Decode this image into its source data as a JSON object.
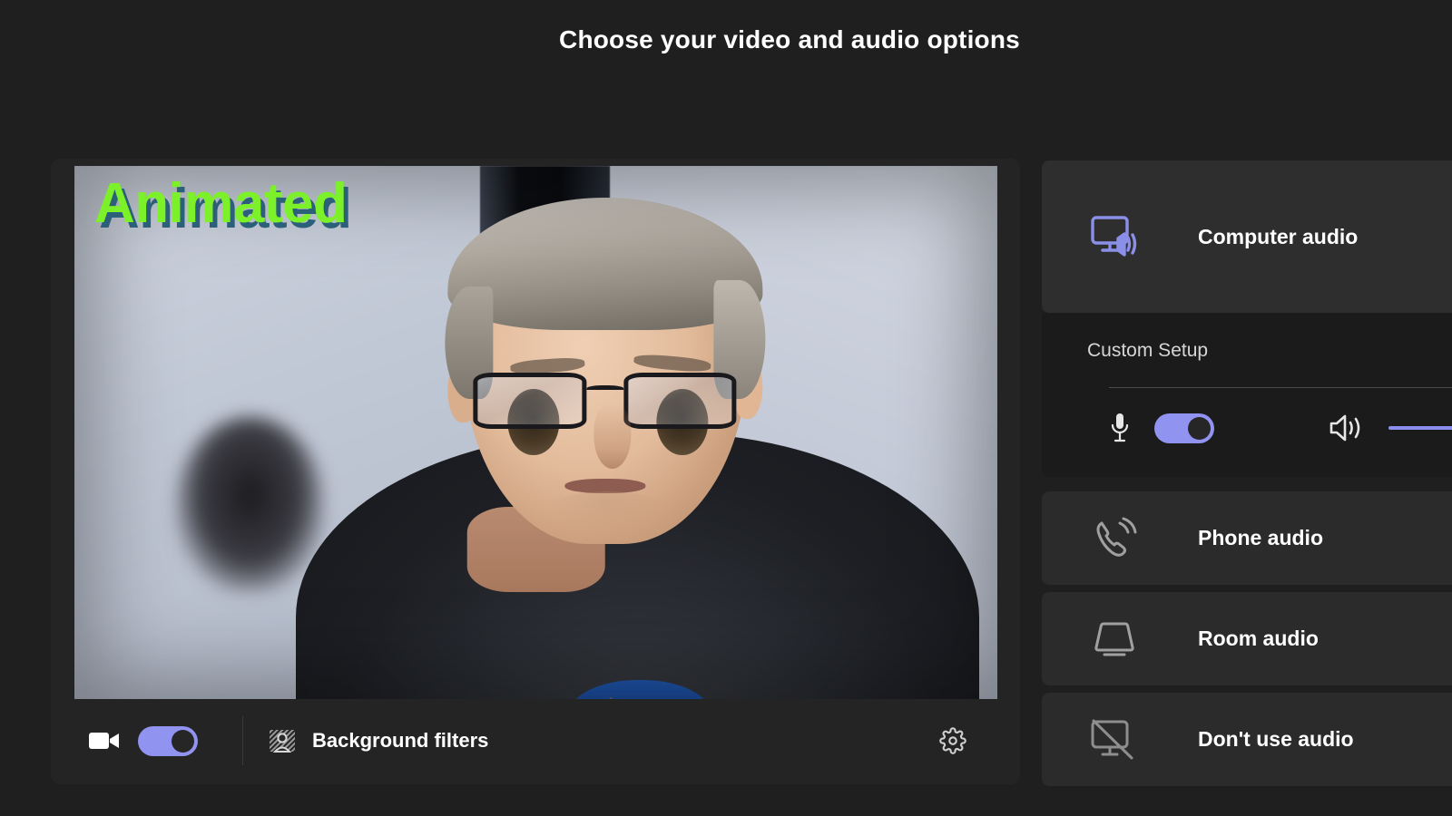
{
  "header": {
    "title": "Choose your video and audio options"
  },
  "video_preview": {
    "overlay_text": "Animated",
    "overlay_text_color": "#7CF028",
    "overlay_shadow_color": "#2C5F7A",
    "scene_description": "Webcam self-view of a person with short gray hair and dark-rimmed glasses wearing a dark hoodie over a blue shirt, in front of a light blue-gray wall"
  },
  "video_controls": {
    "camera_icon": "video-camera-icon",
    "camera_toggle_state": "on",
    "background_filters_icon": "background-filters-icon",
    "background_filters_label": "Background filters",
    "settings_icon": "gear-icon"
  },
  "audio_options": [
    {
      "id": "computer-audio",
      "label": "Computer audio",
      "icon": "computer-speaker-icon",
      "selected": true,
      "icon_color": "#8B8FE8"
    },
    {
      "id": "phone-audio",
      "label": "Phone audio",
      "icon": "phone-ringing-icon",
      "selected": false,
      "icon_color": "#A8A8A8"
    },
    {
      "id": "room-audio",
      "label": "Room audio",
      "icon": "room-device-icon",
      "selected": false,
      "icon_color": "#A8A8A8"
    },
    {
      "id": "dont-use-audio",
      "label": "Don't use audio",
      "icon": "computer-audio-muted-icon",
      "selected": false,
      "icon_color": "#A8A8A8"
    }
  ],
  "custom_setup": {
    "title": "Custom Setup",
    "mic_icon": "microphone-icon",
    "mic_toggle_state": "on",
    "speaker_icon": "speaker-icon",
    "speaker_volume_percent": 100
  },
  "theme": {
    "page_background": "#1F1F1F",
    "card_background": "#2B2B2B",
    "accent_purple": "#9094F0",
    "text_primary": "#FFFFFF",
    "text_secondary": "#D6D6D6"
  }
}
